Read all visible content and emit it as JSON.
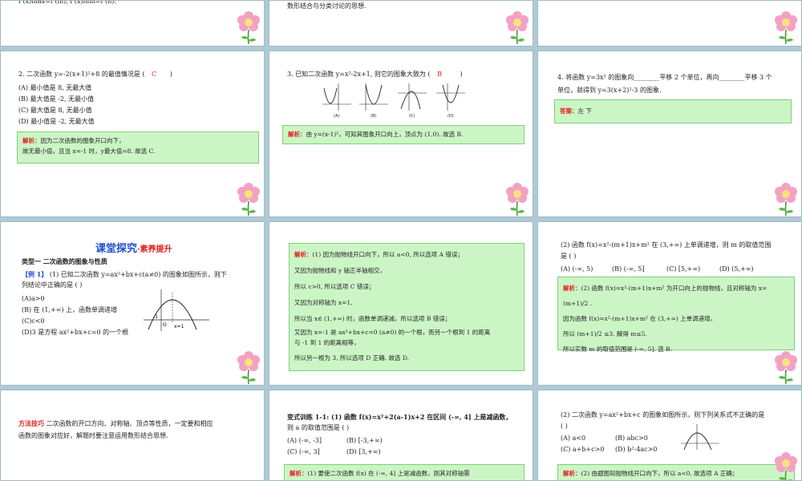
{
  "s1": {
    "top_text": "f (x)max=f (m), f (x)min=f (n)."
  },
  "s2": {
    "top_text": "数形结合与分类讨论的思想."
  },
  "s4": {
    "question": "2. 二次函数 y=-2(x+1)²+8 的最值情况是 (",
    "answer": "C",
    "paren_close": ")",
    "options": [
      "(A) 最小值是 8, 无最大值",
      "(B) 最大值是 -2, 无最小值",
      "(C) 最大值是 8, 无最小值",
      "(D) 最小值是 -2, 无最大值"
    ],
    "sol_label": "解析",
    "sol_line1": "：因为二次函数的图象开口向下，",
    "sol_line2": "故无最小值，且当 x=-1 时，y最大值=8. 故选 C."
  },
  "s5": {
    "question": "3. 已知二次函数 y=x²-2x+1, 则它的图象大致为 (",
    "answer": "B",
    "paren_close": ")",
    "graph_labels": [
      "(A)",
      "(B)",
      "(C)",
      "(D)"
    ],
    "sol_label": "解析",
    "sol_text": "：由 y=(x-1)²，可知其图象开口向上，顶点为 (1,0). 故选 B."
  },
  "s6": {
    "line1": "4. 将函数 y=3x² 的图象向________平移 2 个单位，再向________平移 3 个",
    "line2": "单位，就得到 y=3(x+2)²-3 的图象.",
    "ans_label": "答案",
    "ans_text": "：左    下"
  },
  "s7": {
    "title": "课堂探究",
    "subtitle": "·素养提升",
    "type_line": "类型一    二次函数的图象与性质",
    "ex_label": "【例 1】",
    "ex_line1": "  (1) 已知二次函数 y=ax²+bx+c(a≠0) 的图象如图所示，则下",
    "ex_line2": "列结论中正确的是 (      )",
    "options": [
      "(A)a>0",
      "(B) 在 (1,+∞) 上，函数单调递增",
      "(C)c<0",
      "(D)3 是方程 ax²+bx+c=0 的一个根"
    ],
    "graph_xlabel": "x=1",
    "graph_neg1": "-1",
    "graph_o": "O"
  },
  "s8": {
    "sol_label": "解析",
    "lines": [
      "：(1) 因为抛物线开口向下，所以 a<0, 所以选项 A 错误；",
      "又因为抛物线和 y 轴正半轴相交，",
      "所以 c>0, 所以选项 C 错误；",
      "又因为对称轴为 x=1,",
      "所以当 x∈ (1,+∞) 时，函数单调递减，所以选项 B 错误；",
      "又因为 x=-1 是 ax²+bx+c=0 (a≠0) 的一个根，而另一个根到 1 的距离",
      "与 -1 到 1 的距离相等，",
      "所以另一根为 3, 所以选项 D 正确. 故选 D."
    ]
  },
  "s9": {
    "q_line1": "(2) 函数 f(x)=x²-(m+1)x+m² 在 (3,+∞) 上单调递增，则 m 的取值范围",
    "q_line2": "是 (      )",
    "options": [
      "(A) (-∞, 5)",
      "(B) (-∞, 5]",
      "(C) [5,+∞)",
      "(D) (5,+∞)"
    ],
    "sol_label": "解析",
    "lines": [
      "：(2) 函数 f(x)=x²-(m+1)x+m² 为开口向上的抛物线，且对称轴为 x= (m+1)/2 .",
      "因为函数 f(x)=x²-(m+1)x+m² 在 (3,+∞) 上单调递增，",
      "所以 (m+1)/2 ≤3, 解得 m≤5.",
      "所以实数 m 的取值范围是 (-∞, 5]. 选 B."
    ]
  },
  "s10": {
    "label": "方法技巧",
    "line1": "    二次函数的开口方向、对称轴、顶点等性质，一定要和相应",
    "line2": "函数的图象对应好，解题时要注意运用数形结合思想."
  },
  "s11": {
    "line1": "变式训练 1-1: (1) 函数 f(x)=x²+2(a-1)x+2 在区间 (-∞, 4] 上是减函数，",
    "line2": "则 a 的取值范围是 (      )",
    "options": [
      "(A) (-∞, -3]",
      "(B) [-3,+∞)",
      "(C) (-∞, 3]",
      "(D) [3,+∞)"
    ],
    "sol_label": "解析",
    "sol_text": "：(1) 要使二次函数 f(x) 在 (-∞, 4] 上是减函数，则其对称轴需"
  },
  "s12": {
    "line1": "(2) 二次函数 y=ax²+bx+c 的图象如图所示，则下列关系式不正确的是",
    "line2": "(      )",
    "options": [
      "(A) a<0",
      "(B) abc>0",
      "(C) a+b+c>0",
      "(D) b²-4ac>0"
    ],
    "sol_label": "解析",
    "sol_text": "：(2) 由题图知抛物线开口向下，所以 a<0, 故选项 A 正确；"
  },
  "colors": {
    "background": "#afcad5",
    "answer": "#e02020",
    "box": "#ccf5c6",
    "title": "#1e4fd2"
  }
}
